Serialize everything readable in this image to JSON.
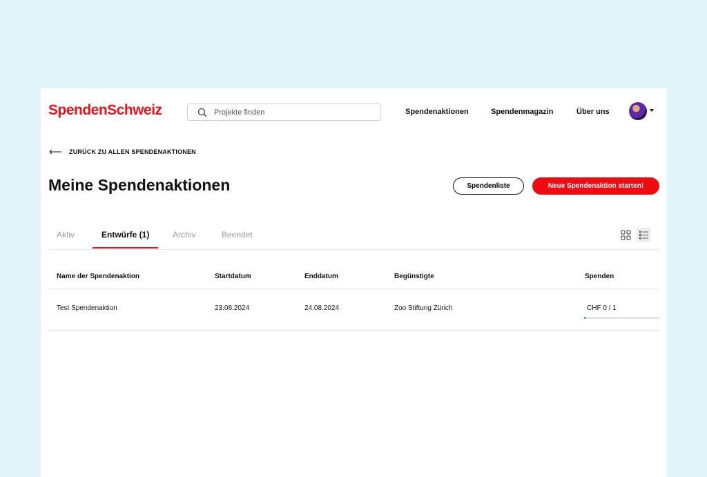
{
  "header": {
    "logo": "SpendenSchweiz",
    "search_placeholder": "Projekte finden",
    "nav": [
      "Spendenaktionen",
      "Spendenmagazin",
      "Über uns"
    ]
  },
  "back_link": "ZURÜCK ZU ALLEN SPENDENAKTIONEN",
  "page_title": "Meine Spendenaktionen",
  "buttons": {
    "donation_list": "Spendenliste",
    "new_campaign": "Neue Spendenaktion starten!"
  },
  "tabs": [
    {
      "label": "Aktiv",
      "active": false
    },
    {
      "label": "Entwürfe (1)",
      "active": true
    },
    {
      "label": "Archiv",
      "active": false
    },
    {
      "label": "Beendet",
      "active": false
    }
  ],
  "view_modes": [
    "grid-view-icon",
    "list-view-icon"
  ],
  "table": {
    "headers": [
      "Name der Spendenaktion",
      "Startdatum",
      "Enddatum",
      "Begünstigte",
      "Spenden"
    ],
    "rows": [
      {
        "name": "Test Spendenaktion",
        "start": "23.08.2024",
        "end": "24.08.2024",
        "beneficiary": "Zoo Stiftung Zürich",
        "donations": "CHF 0 / 1",
        "progress": 0.02
      }
    ]
  },
  "colors": {
    "brand": "#e3141b",
    "background": "#e3f4fb",
    "progress": "#12a04a"
  }
}
